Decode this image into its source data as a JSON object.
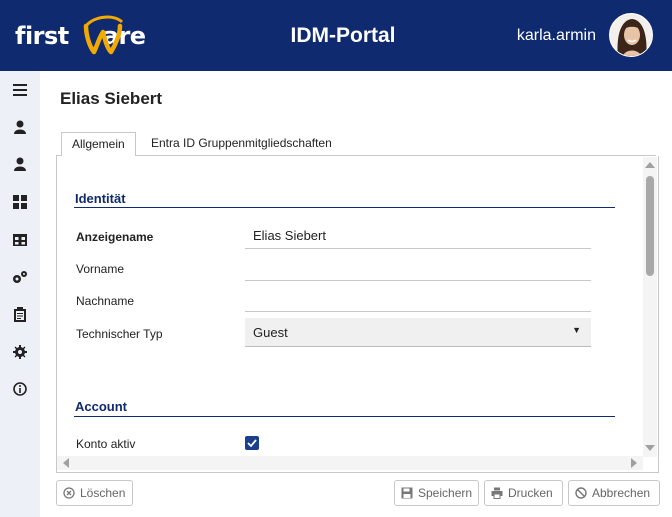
{
  "header": {
    "logo_text_left": "first",
    "logo_text_right": "are",
    "logo_letter": "W",
    "app_title": "IDM-Portal",
    "username": "karla.armin"
  },
  "sidebar": {
    "items": [
      {
        "icon": "menu-icon"
      },
      {
        "icon": "user-icon"
      },
      {
        "icon": "user-icon"
      },
      {
        "icon": "dashboard-icon"
      },
      {
        "icon": "gift-icon"
      },
      {
        "icon": "gears-icon"
      },
      {
        "icon": "clipboard-icon"
      },
      {
        "icon": "gear-icon"
      },
      {
        "icon": "info-icon"
      }
    ]
  },
  "page": {
    "title": "Elias Siebert"
  },
  "tabs": [
    {
      "label": "Allgemein",
      "active": true
    },
    {
      "label": "Entra ID Gruppenmitgliedschaften",
      "active": false
    }
  ],
  "form": {
    "section_identity": "Identität",
    "display_name_label": "Anzeigename",
    "display_name_value": "Elias Siebert",
    "first_name_label": "Vorname",
    "first_name_value": "",
    "last_name_label": "Nachname",
    "last_name_value": "",
    "tech_type_label": "Technischer Typ",
    "tech_type_value": "Guest",
    "section_account": "Account",
    "account_active_label": "Konto aktiv",
    "account_active_checked": true
  },
  "actions": {
    "delete": "Löschen",
    "save": "Speichern",
    "print": "Drucken",
    "cancel": "Abbrechen"
  },
  "colors": {
    "brand": "#0f2a6e",
    "logo_accent": "#f2a900",
    "checkbox": "#1c3f8c"
  }
}
